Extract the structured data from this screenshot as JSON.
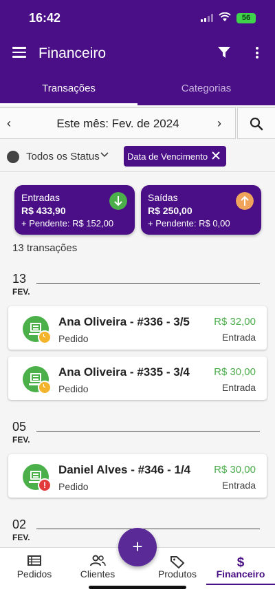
{
  "status_bar": {
    "time": "16:42",
    "battery": "56"
  },
  "app_bar": {
    "title": "Financeiro",
    "menu_icon": "menu-icon",
    "filter_icon": "filter-icon",
    "more_icon": "more-vert-icon"
  },
  "tabs": [
    {
      "label": "Transações",
      "active": true
    },
    {
      "label": "Categorias",
      "active": false
    }
  ],
  "month_selector": {
    "label": "Este mês: Fev. de 2024",
    "prev": "‹",
    "next": "›"
  },
  "filters": {
    "status_label": "Todos os Status",
    "chip_label": "Data de Vencimento"
  },
  "summary": {
    "entradas": {
      "title": "Entradas",
      "value": "R$ 433,90",
      "pending": "+ Pendente: R$ 152,00",
      "color": "#4cb04a"
    },
    "saidas": {
      "title": "Saídas",
      "value": "R$ 250,00",
      "pending": "+ Pendente: R$ 0,00",
      "color": "#f0a35a"
    }
  },
  "count_label": "13 transações",
  "groups": [
    {
      "day": "13",
      "month": "FEV.",
      "items": [
        {
          "title": "Ana Oliveira - #336 - 3/5",
          "subtitle": "Pedido",
          "amount": "R$ 32,00",
          "type": "Entrada",
          "badge": "clock"
        },
        {
          "title": "Ana Oliveira - #335 - 3/4",
          "subtitle": "Pedido",
          "amount": "R$ 30,00",
          "type": "Entrada",
          "badge": "clock"
        }
      ]
    },
    {
      "day": "05",
      "month": "FEV.",
      "items": [
        {
          "title": "Daniel Alves - #346 - 1/4",
          "subtitle": "Pedido",
          "amount": "R$ 30,00",
          "type": "Entrada",
          "badge": "alert"
        }
      ]
    },
    {
      "day": "02",
      "month": "FEV.",
      "items": []
    }
  ],
  "bottom_nav": [
    {
      "label": "Pedidos",
      "icon": "list-icon"
    },
    {
      "label": "Clientes",
      "icon": "people-icon"
    },
    {
      "label": "Produtos",
      "icon": "tag-icon"
    },
    {
      "label": "Financeiro",
      "icon": "dollar-icon",
      "active": true
    }
  ],
  "fab_label": "+"
}
